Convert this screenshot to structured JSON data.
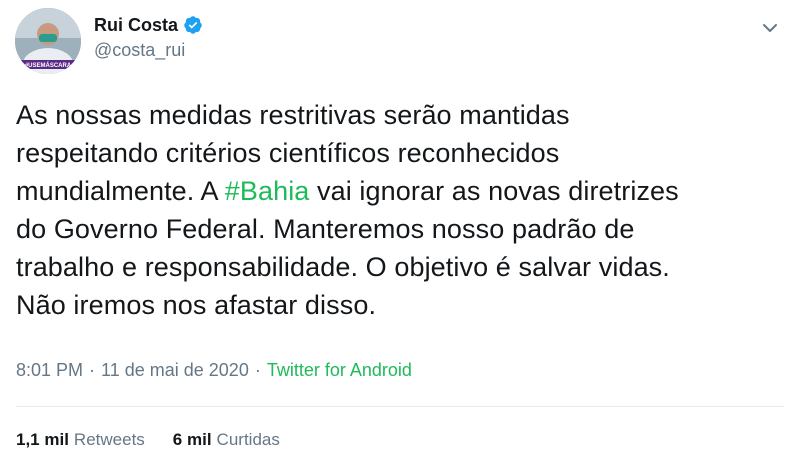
{
  "author": {
    "display_name": "Rui Costa",
    "handle": "@costa_rui",
    "verified": true,
    "avatar_badge_text": "#USEMÁSCARA"
  },
  "tweet": {
    "text_before": "As nossas medidas restritivas serão mantidas\nrespeitando critérios científicos reconhecidos\nmundialmente. A ",
    "hashtag": "#Bahia",
    "text_after": " vai ignorar as novas diretrizes\ndo Governo Federal. Manteremos nosso padrão de\ntrabalho e responsabilidade. O objetivo é salvar vidas.\nNão iremos nos afastar disso."
  },
  "meta": {
    "time": "8:01 PM",
    "separator": "·",
    "date": "11 de mai de 2020",
    "source": "Twitter for Android"
  },
  "stats": {
    "retweets_count": "1,1 mil",
    "retweets_label": "Retweets",
    "likes_count": "6 mil",
    "likes_label": "Curtidas"
  },
  "icons": {
    "verified": "verified-badge-icon",
    "menu": "chevron-down-icon"
  },
  "colors": {
    "verified": "#1da1f2",
    "link": "#1fba5a",
    "secondary_text": "#657786",
    "primary_text": "#14171a"
  }
}
